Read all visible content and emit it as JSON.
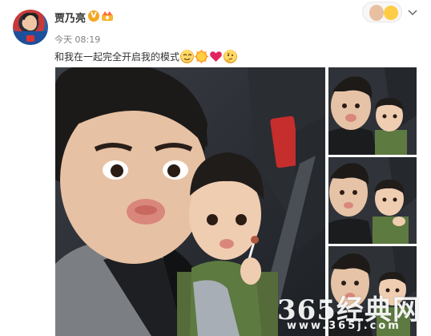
{
  "post": {
    "username": "贾乃亮",
    "verified_badge": "V",
    "timestamp": "今天 08:19",
    "text": "和我在一起完全开启我的模式",
    "emojis": [
      "squint-face",
      "sun",
      "heart",
      "thinking-face"
    ]
  },
  "header_icons": {
    "card": "user-card-icon",
    "menu": "chevron-down-icon"
  },
  "photos": {
    "main": "selfie-main",
    "thumbnails": [
      "selfie-thumb-1",
      "selfie-thumb-2",
      "selfie-thumb-3"
    ]
  },
  "watermark": {
    "main": "365经典网",
    "sub": "www.365j.com"
  },
  "colors": {
    "accent": "#f5a623",
    "timestamp": "#808080",
    "text": "#333333",
    "heart": "#e0245e"
  }
}
